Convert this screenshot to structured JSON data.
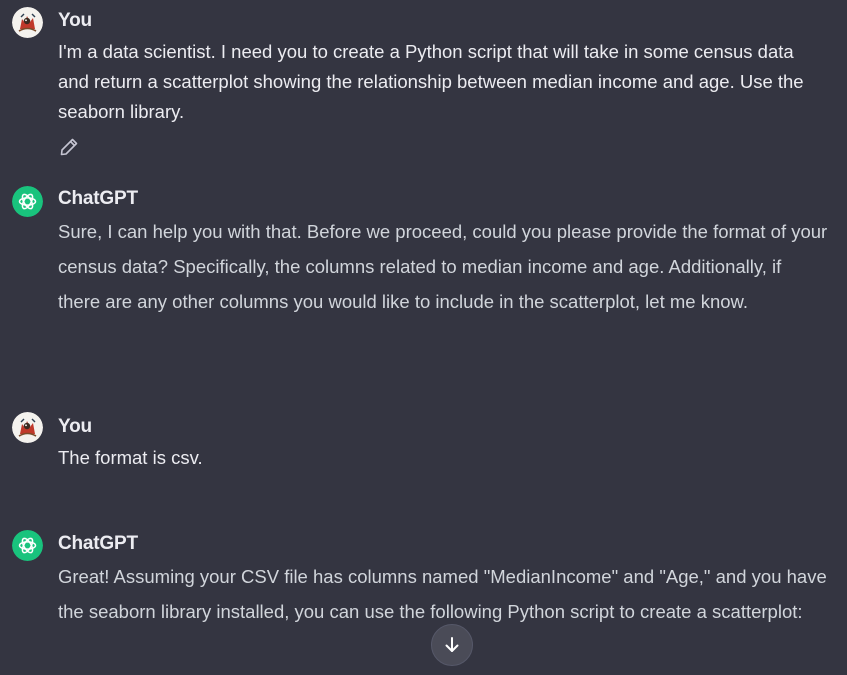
{
  "messages": [
    {
      "role": "user",
      "author": "You",
      "text": "I'm a data scientist. I need you to create a Python script that will take in some census data and return a scatterplot showing the relationship between median income and age. Use the seaborn library."
    },
    {
      "role": "assistant",
      "author": "ChatGPT",
      "text": "Sure, I can help you with that. Before we proceed, could you please provide the format of your census data? Specifically, the columns related to median income and age. Additionally, if there are any other columns you would like to include in the scatterplot, let me know."
    },
    {
      "role": "user",
      "author": "You",
      "text": "The format is csv."
    },
    {
      "role": "assistant",
      "author": "ChatGPT",
      "text": "Great! Assuming your CSV file has columns named \"MedianIncome\" and \"Age,\" and you have the seaborn library installed, you can use the following Python script to create a scatterplot:"
    }
  ],
  "icons": {
    "edit": "pencil-icon",
    "scroll": "arrow-down-icon",
    "assistant_avatar": "openai-logo-icon",
    "user_avatar": "user-avatar-icon"
  },
  "colors": {
    "background": "#343541",
    "text": "#ececf1",
    "assistant_avatar_bg": "#19c37d",
    "scroll_button_bg": "#4a4b57"
  }
}
